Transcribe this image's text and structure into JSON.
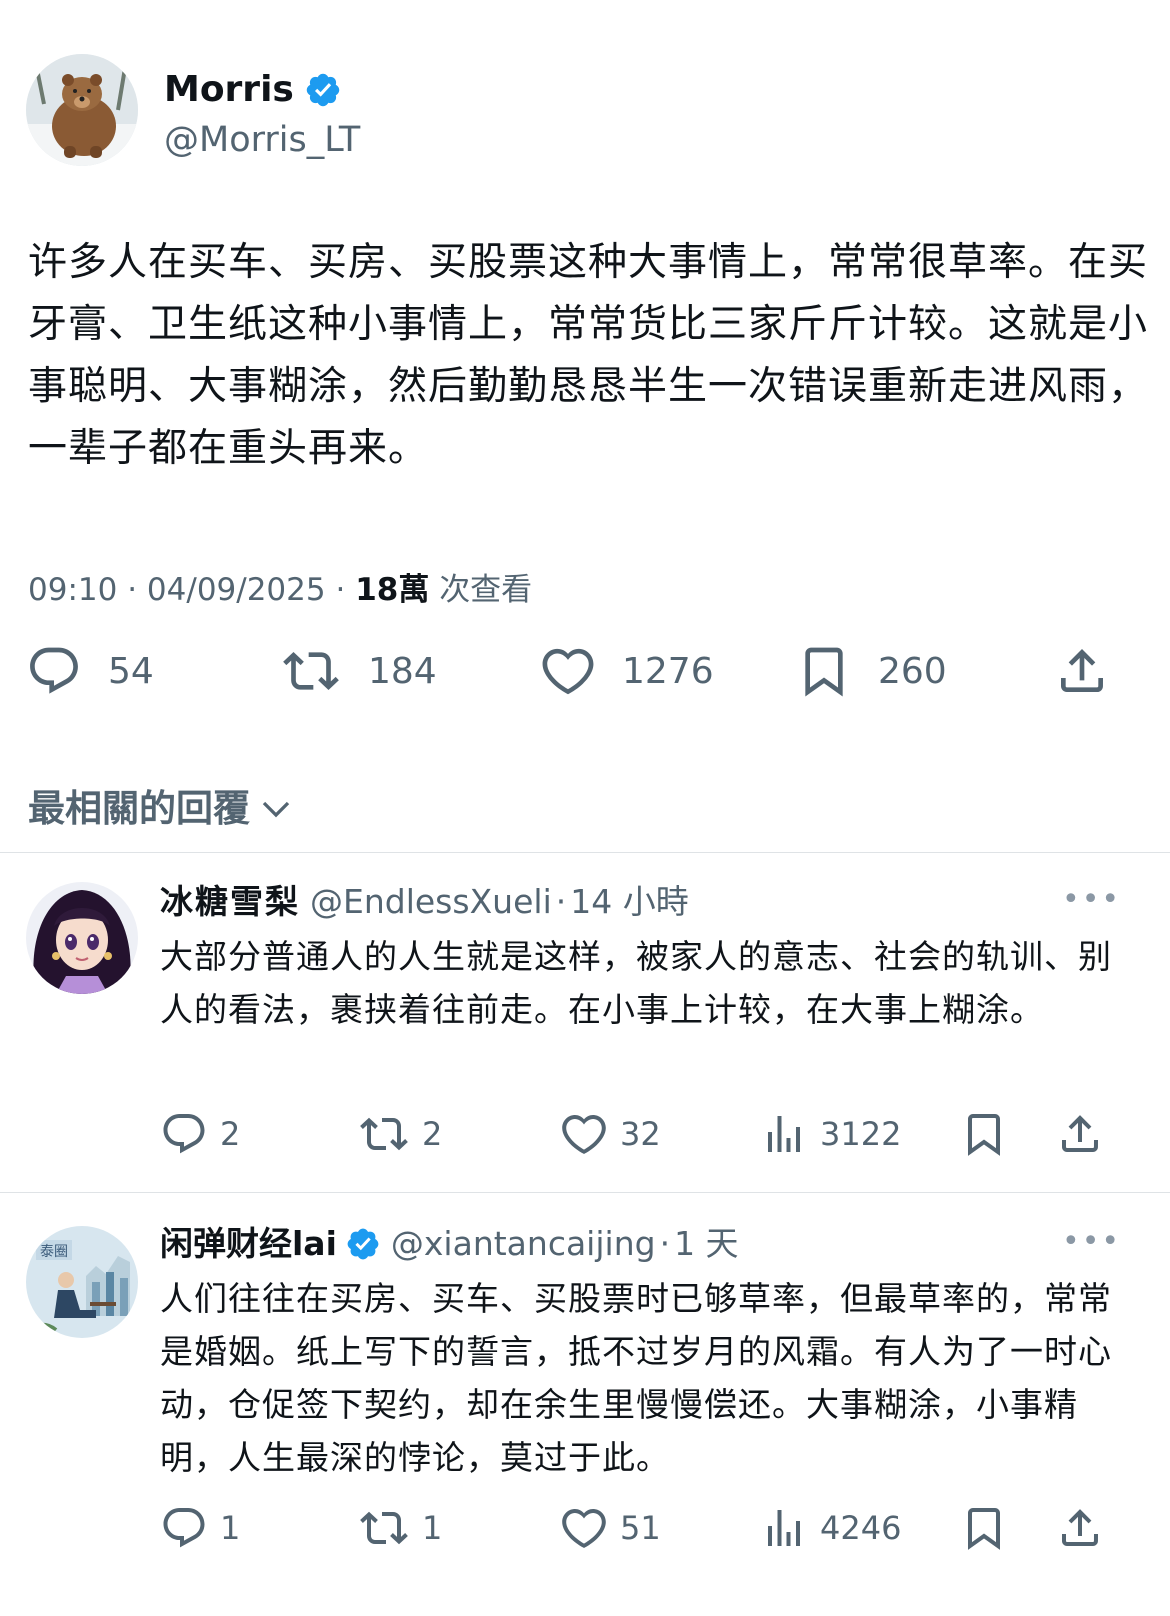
{
  "main_tweet": {
    "author_name": "Morris",
    "author_handle": "@Morris_LT",
    "verified": true,
    "text": "许多人在买车、买房、买股票这种大事情上，常常很草率。在买牙膏、卫生纸这种小事情上，常常货比三家斤斤计较。这就是小事聪明、大事糊涂，然后勤勤恳恳半生一次错误重新走进风雨，一辈子都在重头再来。",
    "time": "09:10",
    "date": "04/09/2025",
    "views_count": "18萬",
    "views_label": "次查看",
    "actions": {
      "replies": "54",
      "retweets": "184",
      "likes": "1276",
      "bookmarks": "260"
    }
  },
  "sort_label": "最相關的回覆",
  "replies": [
    {
      "author_name": "冰糖雪梨",
      "author_handle": "@EndlessXueli",
      "time_ago": "14 小時",
      "verified": false,
      "text": "大部分普通人的人生就是这样，被家人的意志、社会的轨训、别人的看法，裹挟着往前走。在小事上计较，在大事上糊涂。",
      "replies": "2",
      "retweets": "2",
      "likes": "32",
      "views": "3122"
    },
    {
      "author_name": "闲弹财经lai",
      "author_handle": "@xiantancaijing",
      "time_ago": "1 天",
      "verified": true,
      "text": "人们往往在买房、买车、买股票时已够草率，但最草率的，常常是婚姻。纸上写下的誓言，抵不过岁月的风霜。有人为了一时心动，仓促签下契约，却在余生里慢慢偿还。大事糊涂，小事精明，人生最深的悖论，莫过于此。",
      "replies": "1",
      "retweets": "1",
      "likes": "51",
      "views": "4246"
    }
  ],
  "colors": {
    "text": "#0f1419",
    "secondary": "#536471",
    "verified": "#1d9bf0",
    "divider": "#dfe3e6"
  },
  "icons": [
    "verified-badge-icon",
    "reply-icon",
    "retweet-icon",
    "like-icon",
    "bookmark-icon",
    "share-icon",
    "views-icon",
    "chevron-down-icon",
    "more-icon"
  ]
}
